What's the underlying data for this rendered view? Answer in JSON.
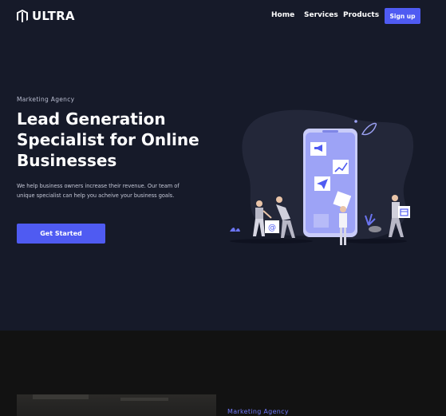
{
  "nav": {
    "logo_text": "ULTRA",
    "links": [
      "Home",
      "Services",
      "Products"
    ],
    "signup_label": "Sign up"
  },
  "hero": {
    "eyebrow": "Marketing Agency",
    "headline": "Lead Generation Specialist for Online Businesses",
    "subtext": "We help business owners increase their revenue. Our team of unique specialist can help you acheive your business goals.",
    "cta_label": "Get Started"
  },
  "section2": {
    "eyebrow": "Marketing Agency"
  },
  "colors": {
    "background": "#161a29",
    "accent": "#4f5bf2",
    "dark_section": "#121212",
    "illustration_blob": "#232739",
    "phone": "#9da3f6"
  },
  "icons": [
    "logo-icon",
    "megaphone-icon",
    "chart-icon",
    "paper-plane-icon",
    "email-at-icon",
    "calendar-icon",
    "leaf-icon",
    "plant-icon"
  ]
}
